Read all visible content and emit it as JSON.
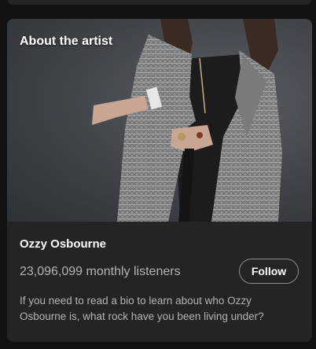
{
  "about_section": {
    "title": "About the artist",
    "image_alt": "Ozzy Osbourne in a plaid suit jacket holding a cane",
    "artist_name": "Ozzy Osbourne",
    "monthly_listeners": "23,096,099 monthly listeners",
    "follow_label": "Follow",
    "bio": "If you need to read a bio to learn about who Ozzy Osbourne is, what rock have you been living under?"
  },
  "colors": {
    "background": "#121212",
    "card": "#242424",
    "text_primary": "#ffffff",
    "text_secondary": "#b3b3b3"
  }
}
